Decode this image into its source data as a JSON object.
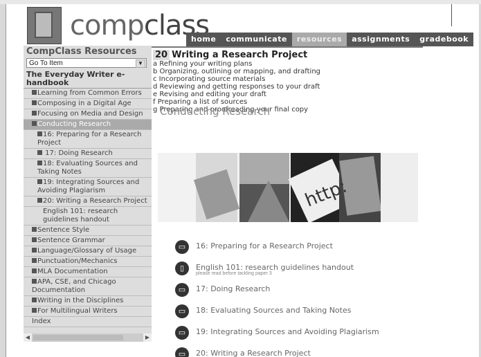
{
  "app": {
    "logo_pre": "comp",
    "logo_post": "class"
  },
  "nav": {
    "items": [
      "home",
      "communicate",
      "resources",
      "assignments",
      "gradebook"
    ],
    "active": 2
  },
  "sidebar": {
    "title": "CompClass Resources",
    "goto": "Go To Item",
    "book": "The Everyday Writer e-handbook",
    "items": [
      {
        "label": "Learning from Common Errors",
        "lvl": 1
      },
      {
        "label": "Composing in a Digital Age",
        "lvl": 1
      },
      {
        "label": "Focusing on Media and Design",
        "lvl": 1
      },
      {
        "label": "Conducting Research",
        "lvl": 1,
        "active": true
      },
      {
        "label": "16: Preparing for a Research Project",
        "lvl": 2
      },
      {
        "label": " 17: Doing Research",
        "lvl": 2
      },
      {
        "label": "18: Evaluating Sources and Taking Notes",
        "lvl": 2
      },
      {
        "label": "19: Integrating Sources and Avoiding Plagiarism",
        "lvl": 2
      },
      {
        "label": "20: Writing a Research Project",
        "lvl": 2
      },
      {
        "label": "English 101: research guidelines handout",
        "lvl": 3
      },
      {
        "label": "Sentence Style",
        "lvl": 1
      },
      {
        "label": "Sentence Grammar",
        "lvl": 1
      },
      {
        "label": "Language/Glossary of Usage",
        "lvl": 1
      },
      {
        "label": "Punctuation/Mechanics",
        "lvl": 1
      },
      {
        "label": "MLA Documentation",
        "lvl": 1
      },
      {
        "label": "APA, CSE, and Chicago Documentation",
        "lvl": 1
      },
      {
        "label": "Writing in the Disciplines",
        "lvl": 1
      },
      {
        "label": "For Multilingual Writers",
        "lvl": 1
      },
      {
        "label": "Index",
        "lvl": 0
      }
    ]
  },
  "chapter": {
    "num": "20",
    "title": "Writing a Research Project",
    "sections": [
      "a Refining your writing plans",
      "b Organizing, outlining or mapping, and drafting",
      "c Incorporating source materials",
      "d Reviewing and getting responses to your draft",
      "e Revising and editing your draft",
      "f Preparing a list of sources",
      "g Preparing and proofreading your final copy"
    ]
  },
  "main": {
    "heading": "Conducting Research"
  },
  "links": [
    {
      "icon": "folder-icon",
      "label": "16: Preparing for a Research Project",
      "sub": ""
    },
    {
      "icon": "document-icon",
      "label": "English 101: research guidelines handout",
      "sub": "please read before tackling paper 3"
    },
    {
      "icon": "folder-icon",
      "label": "17: Doing Research",
      "sub": ""
    },
    {
      "icon": "folder-icon",
      "label": "18: Evaluating Sources and Taking Notes",
      "sub": ""
    },
    {
      "icon": "folder-icon",
      "label": "19: Integrating Sources and Avoiding Plagiarism",
      "sub": ""
    },
    {
      "icon": "folder-icon",
      "label": "20: Writing a Research Project",
      "sub": ""
    }
  ],
  "banner": {
    "http_text": "http:"
  }
}
